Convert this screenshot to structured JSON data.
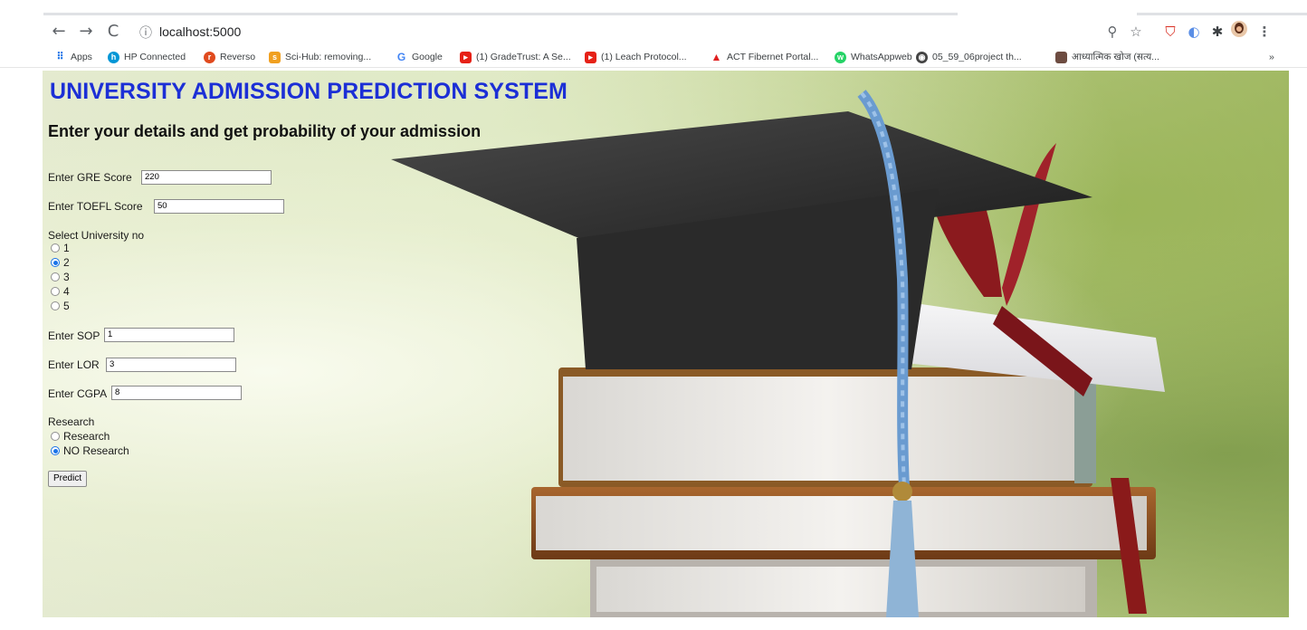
{
  "browser": {
    "url": "localhost:5000",
    "bookmarks": [
      {
        "label": "Apps",
        "icon": "apps-grid-icon",
        "color": "#1a73e8"
      },
      {
        "label": "HP Connected",
        "icon": "hp-icon",
        "color": "#0096d6"
      },
      {
        "label": "Reverso",
        "icon": "reverso-icon",
        "color": "#e04a1e"
      },
      {
        "label": "Sci-Hub: removing...",
        "icon": "scihub-icon",
        "color": "#f0a020"
      },
      {
        "label": "Google",
        "icon": "google-icon",
        "color": "#4285f4"
      },
      {
        "label": "(1) GradeTrust: A Se...",
        "icon": "youtube-icon",
        "color": "#e62117"
      },
      {
        "label": "(1) Leach Protocol...",
        "icon": "youtube-icon",
        "color": "#e62117"
      },
      {
        "label": "ACT Fibernet Portal...",
        "icon": "act-icon",
        "color": "#e02020"
      },
      {
        "label": "WhatsAppweb",
        "icon": "whatsapp-icon",
        "color": "#25d366"
      },
      {
        "label": "05_59_06project th...",
        "icon": "globe-icon",
        "color": "#444444"
      },
      {
        "label": "आध्यात्मिक खोज (सत्य...",
        "icon": "site-thumb-icon",
        "color": "#6d4c41"
      }
    ],
    "more_bookmarks": "»"
  },
  "page": {
    "title": "UNIVERSITY ADMISSION PREDICTION SYSTEM",
    "subtitle": "Enter your details and get probability of your admission",
    "gre": {
      "label": "Enter GRE Score",
      "value": "220"
    },
    "toefl": {
      "label": "Enter TOEFL Score",
      "value": "50"
    },
    "university": {
      "label": "Select University no",
      "options": [
        "1",
        "2",
        "3",
        "4",
        "5"
      ],
      "selected": "2"
    },
    "sop": {
      "label": "Enter SOP",
      "value": "1"
    },
    "lor": {
      "label": "Enter LOR",
      "value": "3"
    },
    "cgpa": {
      "label": "Enter CGPA",
      "value": "8"
    },
    "research": {
      "label": "Research",
      "options": [
        "Research",
        "NO Research"
      ],
      "selected": "NO Research"
    },
    "predict_label": "Predict"
  }
}
